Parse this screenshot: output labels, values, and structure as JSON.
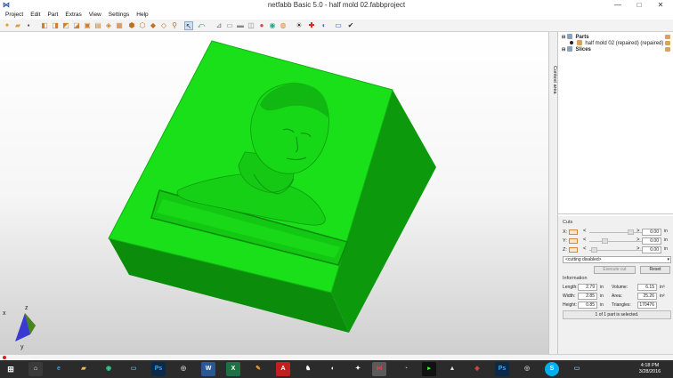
{
  "window": {
    "title": "netfabb Basic 5.0 - half mold 02.fabbproject",
    "minimize": "—",
    "maximize": "□",
    "close": "✕"
  },
  "menu": [
    "Project",
    "Edit",
    "Part",
    "Extras",
    "View",
    "Settings",
    "Help"
  ],
  "sidebar_tab": "Context area",
  "tree": {
    "parts": "Parts",
    "part": "half mold 02 (repaired) (repaired)",
    "slices": "Slices"
  },
  "cuts": {
    "label": "Cuts",
    "rows": [
      {
        "axis": "X:",
        "lt": "<",
        "gt": ">",
        "value": "0.00",
        "unit": "in",
        "thumb": 0.92
      },
      {
        "axis": "Y:",
        "lt": "<",
        "gt": ">",
        "value": "0.00",
        "unit": "in",
        "thumb": 0.5
      },
      {
        "axis": "Z:",
        "lt": "<",
        "gt": ">",
        "value": "0.00",
        "unit": "in",
        "thumb": 0.08
      }
    ],
    "mode": "<cutting disabled>",
    "execute": "Execute cut",
    "reset": "Reset"
  },
  "information": {
    "label": "Information",
    "length_label": "Length:",
    "length": "2.79",
    "length_unit": "in",
    "width_label": "Width:",
    "width": "2.85",
    "width_unit": "in",
    "height_label": "Height:",
    "height": "0.85",
    "height_unit": "in",
    "volume_label": "Volume:",
    "volume": "6.15",
    "volume_unit": "in³",
    "area_label": "Area:",
    "area": "25.26",
    "area_unit": "in²",
    "triangles_label": "Triangles:",
    "triangles": "170476"
  },
  "status": "1 of 1 part is selected.",
  "axes": {
    "x": "x",
    "y": "y",
    "z": "z"
  },
  "clock": {
    "time": "4:18 PM",
    "date": "3/28/2016"
  },
  "colors": {
    "mold": "#18e018",
    "mold_side": "#0fa00f",
    "mold_front": "#0a8a0a",
    "accent": "#2a4fa8"
  },
  "taskbar_icons": [
    "start",
    "explorer",
    "ie",
    "folder",
    "media",
    "screen",
    "photoshop",
    "chrome",
    "word",
    "excel",
    "paint",
    "acrobat",
    "inkscape",
    "media-player",
    "app",
    "netfabb",
    "network",
    "cmd",
    "app2",
    "app3",
    "ps2",
    "app4",
    "skype",
    "app5"
  ]
}
